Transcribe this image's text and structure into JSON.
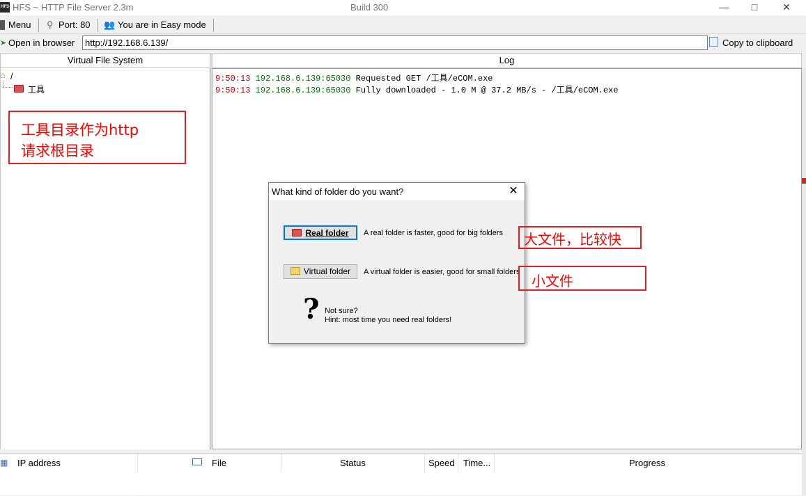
{
  "window": {
    "title": "HFS ~ HTTP File Server 2.3m",
    "build": "Build 300",
    "app_icon_text": "HFS"
  },
  "toolbar": {
    "menu_label": "Menu",
    "port_label": "Port: 80",
    "mode_label": "You are in Easy mode"
  },
  "urlbar": {
    "open_label": "Open in browser",
    "url_value": "http://192.168.6.139/",
    "copy_label": "Copy to clipboard"
  },
  "vfs": {
    "header": "Virtual File System",
    "root_label": "/",
    "folder_label": "工具"
  },
  "log": {
    "header": "Log",
    "lines": [
      {
        "time": "9:50:13",
        "addr": "192.168.6.139:65030",
        "msg": "Requested GET /工具/eCOM.exe"
      },
      {
        "time": "9:50:13",
        "addr": "192.168.6.139:65030",
        "msg": "Fully downloaded - 1.0 M @ 37.2 MB/s - /工具/eCOM.exe"
      }
    ]
  },
  "connections": {
    "columns": [
      "IP address",
      "File",
      "Status",
      "Speed",
      "Time...",
      "Progress"
    ]
  },
  "dialog": {
    "title": "What kind of folder do you want?",
    "real_button": "Real folder",
    "real_desc": "A real folder is faster, good for big folders",
    "virtual_button": "Virtual folder",
    "virtual_desc": "A virtual folder is easier, good for small folders",
    "question_mark": "?",
    "hint_line1": "Not sure?",
    "hint_line2": "Hint: most time you need real folders!"
  },
  "annotations": {
    "root_note_line1": "工具目录作为http",
    "root_note_line2": "请求根目录",
    "big_files_note": "大文件，比较快",
    "small_files_note": "小文件"
  },
  "colors": {
    "annotation_red": "#e02020",
    "log_time_red": "#c00000",
    "log_addr_green": "#007000",
    "default_button_blue": "#0078d7"
  }
}
